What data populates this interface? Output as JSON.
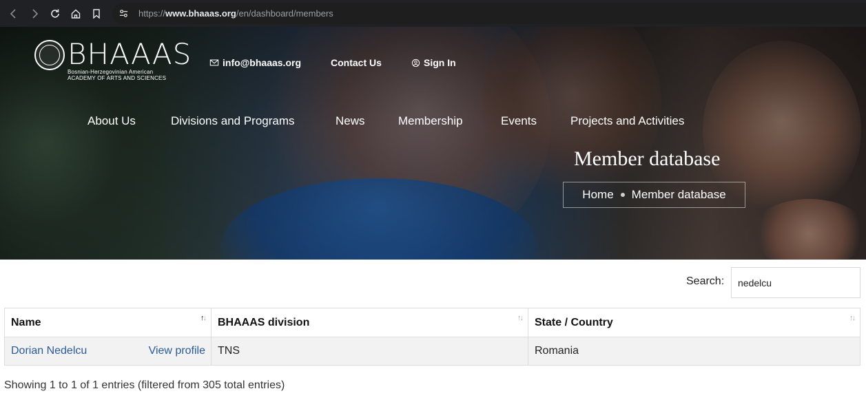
{
  "browser": {
    "url_prefix": "https://",
    "url_domain": "www.bhaaas.org",
    "url_path": "/en/dashboard/members"
  },
  "logo": {
    "word": "BHAAAS",
    "subtitle_line1": "Bosnian-Herzegovinian American",
    "subtitle_line2": "ACADEMY OF ARTS AND SCIENCES"
  },
  "topnav": {
    "email": "info@bhaaas.org",
    "contact": "Contact Us",
    "signin": "Sign In"
  },
  "mainnav": {
    "items": [
      "About Us",
      "Divisions and Programs",
      "News",
      "Membership",
      "Events",
      "Projects and Activities"
    ]
  },
  "hero": {
    "title": "Member database",
    "breadcrumb_home": "Home",
    "breadcrumb_current": "Member database"
  },
  "search": {
    "label": "Search:",
    "value": "nedelcu"
  },
  "table": {
    "columns": [
      "Name",
      "BHAAAS division",
      "State / Country"
    ],
    "rows": [
      {
        "name": "Dorian Nedelcu",
        "action": "View profile",
        "division": "TNS",
        "country": "Romania"
      }
    ]
  },
  "info": "Showing 1 to 1 of 1 entries (filtered from 305 total entries)"
}
